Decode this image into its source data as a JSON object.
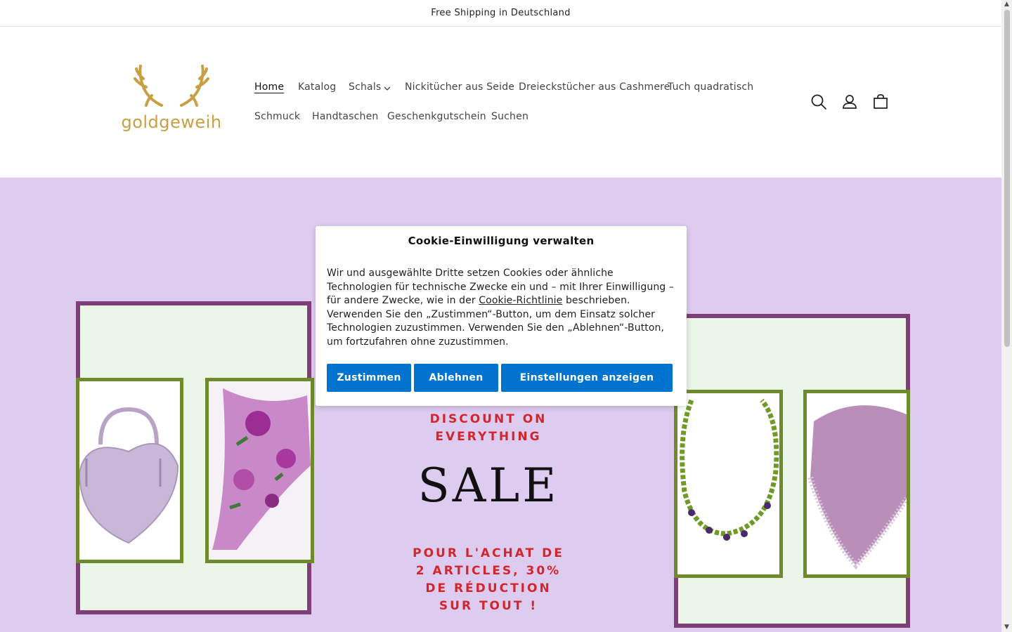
{
  "announcement": "Free Shipping in Deutschland",
  "brand": {
    "name": "goldgeweih",
    "gold": "#c99f44"
  },
  "nav": {
    "home": "Home",
    "katalog": "Katalog",
    "schals": "Schals",
    "nicki": "Nickitücher aus Seide",
    "dreieck": "Dreieckstücher aus Cashmere",
    "tuch": "Tuch quadratisch",
    "schmuck": "Schmuck",
    "handtaschen": "Handtaschen",
    "gutschein": "Geschenkgutschein",
    "suchen": "Suchen"
  },
  "header_icons": [
    "search-icon",
    "account-icon",
    "cart-icon"
  ],
  "hero": {
    "bg": "#decbf0",
    "discount_line1": "DISCOUNT ON",
    "discount_line2": "EVERYTHING",
    "sale": "SALE",
    "fr_line1": "POUR L'ACHAT DE",
    "fr_line2": "2 ARTICLES, 30%",
    "fr_line3": "DE RÉDUCTION",
    "fr_line4": "SUR TOUT !"
  },
  "cookie": {
    "title": "Cookie-Einwilligung verwalten",
    "text_before": "Wir und ausgewählte Dritte setzen Cookies oder ähnliche Technologien für technische Zwecke ein und – mit Ihrer Einwilligung – für andere Zwecke, wie in der ",
    "link": "Cookie-Richtlinie",
    "text_after": " beschrieben. Verwenden Sie den „Zustimmen“-Button, um dem Einsatz solcher Technologien zuzustimmen. Verwenden Sie den „Ablehnen“-Button, um fortzufahren ohne zuzustimmen.",
    "accept": "Zustimmen",
    "reject": "Ablehnen",
    "settings": "Einstellungen anzeigen",
    "button_color": "#0073ce"
  }
}
